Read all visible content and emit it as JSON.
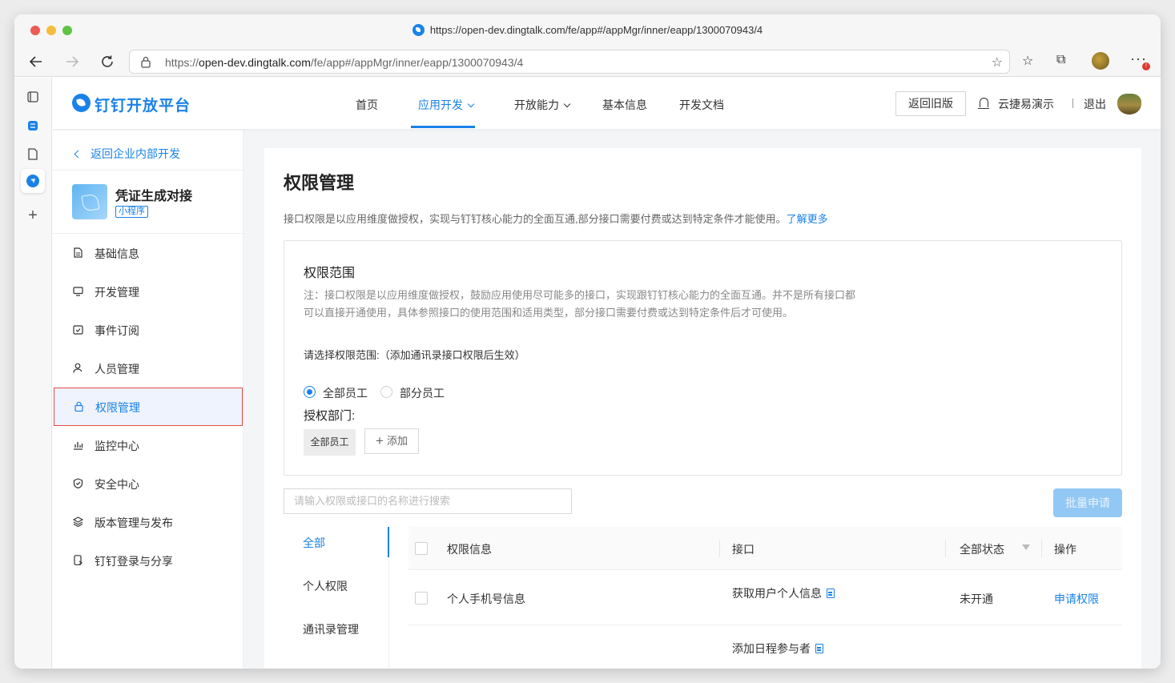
{
  "browser": {
    "window_title": "https://open-dev.dingtalk.com/fe/app#/appMgr/inner/eapp/1300070943/4",
    "url_prefix": "https://",
    "url_host": "open-dev.dingtalk.com",
    "url_path": "/fe/app#/appMgr/inner/eapp/1300070943/4",
    "icons": {
      "back": "arrow-left-icon",
      "forward": "arrow-right-icon",
      "reload": "reload-icon",
      "lock": "lock-icon",
      "favorite_add": "star-plus-icon",
      "favorites": "star-list-icon",
      "collections": "collections-icon",
      "menu": "more-dots-icon"
    },
    "badge": "!"
  },
  "header": {
    "logo_text": "钉钉开放平台",
    "nav": [
      {
        "label": "首页"
      },
      {
        "label": "应用开发",
        "active": true
      },
      {
        "label": "开放能力"
      },
      {
        "label": "基本信息"
      },
      {
        "label": "开发文档"
      }
    ],
    "old_version_label": "返回旧版",
    "user_name": "云捷易演示",
    "logout_label": "退出"
  },
  "sidebar": {
    "back_label": "返回企业内部开发",
    "app_name": "凭证生成对接",
    "app_type": "小程序",
    "items": [
      {
        "label": "基础信息",
        "icon": "document-icon"
      },
      {
        "label": "开发管理",
        "icon": "monitor-icon"
      },
      {
        "label": "事件订阅",
        "icon": "calendar-check-icon"
      },
      {
        "label": "人员管理",
        "icon": "user-icon"
      },
      {
        "label": "权限管理",
        "icon": "lock-icon",
        "active": true
      },
      {
        "label": "监控中心",
        "icon": "bar-chart-icon"
      },
      {
        "label": "安全中心",
        "icon": "shield-icon"
      },
      {
        "label": "版本管理与发布",
        "icon": "layers-icon"
      },
      {
        "label": "钉钉登录与分享",
        "icon": "phone-share-icon"
      }
    ]
  },
  "main": {
    "title": "权限管理",
    "description": "接口权限是以应用维度做授权，实现与钉钉核心能力的全面互通,部分接口需要付费或达到特定条件才能使用。",
    "learn_more": "了解更多",
    "scope": {
      "title": "权限范围",
      "note": "注：接口权限是以应用维度做授权，鼓励应用使用尽可能多的接口，实现跟钉钉核心能力的全面互通。并不是所有接口都可以直接开通使用，具体参照接口的使用范围和适用类型，部分接口需要付费或达到特定条件后才可使用。",
      "prompt": "请选择权限范围:（添加通讯录接口权限后生效）",
      "options": [
        {
          "label": "全部员工",
          "checked": true
        },
        {
          "label": "部分员工",
          "checked": false
        }
      ],
      "dept_label": "授权部门:",
      "dept_chip": "全部员工",
      "add_label": "添加"
    },
    "search_placeholder": "请输入权限或接口的名称进行搜索",
    "batch_label": "批量申请",
    "categories": [
      "全部",
      "个人权限",
      "通讯录管理"
    ],
    "table": {
      "headers": {
        "info": "权限信息",
        "api": "接口",
        "status": "全部状态",
        "action": "操作"
      },
      "rows": [
        {
          "info": "个人手机号信息",
          "api": "获取用户个人信息",
          "status": "未开通",
          "action": "申请权限"
        },
        {
          "info": "",
          "api": "添加日程参与者",
          "status": "",
          "action": ""
        }
      ]
    }
  },
  "colors": {
    "accent": "#1a82e8",
    "active_border": "#e24b4b",
    "batch_disabled": "#93c8f4"
  }
}
